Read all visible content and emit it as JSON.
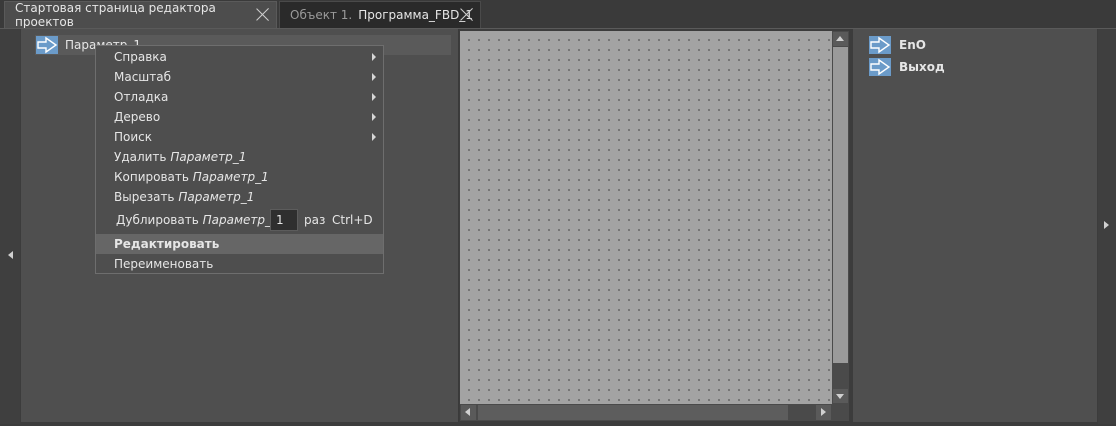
{
  "tabs": [
    {
      "prefix": "",
      "label": "Стартовая страница редактора проектов"
    },
    {
      "prefix": "Объект 1.",
      "label": "Программа_FBD_1"
    }
  ],
  "tree": {
    "item_label": "Параметр_1"
  },
  "context_menu": {
    "items": [
      {
        "label": "Справка",
        "has_submenu": true
      },
      {
        "label": "Масштаб",
        "has_submenu": true
      },
      {
        "label": "Отладка",
        "has_submenu": true
      },
      {
        "label": "Дерево",
        "has_submenu": true
      },
      {
        "label": "Поиск",
        "has_submenu": true
      },
      {
        "label": "Удалить",
        "target": "Параметр_1"
      },
      {
        "label": "Копировать",
        "target": "Параметр_1"
      },
      {
        "label": "Вырезать",
        "target": "Параметр_1"
      }
    ],
    "duplicate": {
      "label": "Дублировать",
      "target": "Параметр_1",
      "count": "1",
      "unit": "раз",
      "shortcut": "Ctrl+D"
    },
    "edit_label": "Редактировать",
    "rename_label": "Переименовать"
  },
  "outputs": [
    {
      "label": "EnO"
    },
    {
      "label": "Выход"
    }
  ],
  "colors": {
    "accent_icon": "#6b9bc9",
    "canvas": "#a3a3a3",
    "panel": "#4f4f4f"
  }
}
